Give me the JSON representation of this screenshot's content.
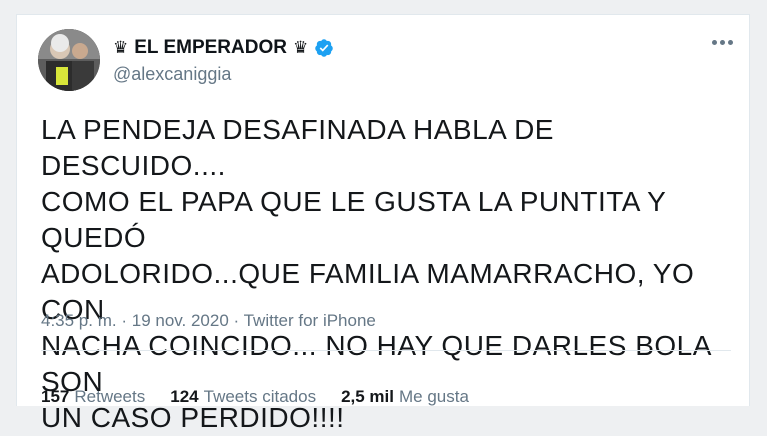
{
  "user": {
    "display_name": "EL EMPERADOR",
    "crown_icon": "♛",
    "handle": "@alexcaniggia",
    "verified": true
  },
  "tweet": {
    "lines": [
      "LA PENDEJA DESAFINADA HABLA DE DESCUIDO....",
      "COMO EL PAPA QUE LE GUSTA LA PUNTITA Y QUEDÓ",
      "ADOLORIDO...QUE FAMILIA MAMARRACHO, YO CON",
      "NACHA COINCIDO... NO HAY QUE DARLES BOLA SON",
      "UN CASO PERDIDO!!!!"
    ],
    "time": "4:35 p. m.",
    "date": "19 nov. 2020",
    "source": "Twitter for iPhone",
    "separator": "·"
  },
  "stats": {
    "retweets_count": "157",
    "retweets_label": "Retweets",
    "quotes_count": "124",
    "quotes_label": "Tweets citados",
    "likes_count": "2,5 mil",
    "likes_label": "Me gusta"
  },
  "colors": {
    "verified": "#1da1f2",
    "secondary_text": "#657786"
  }
}
